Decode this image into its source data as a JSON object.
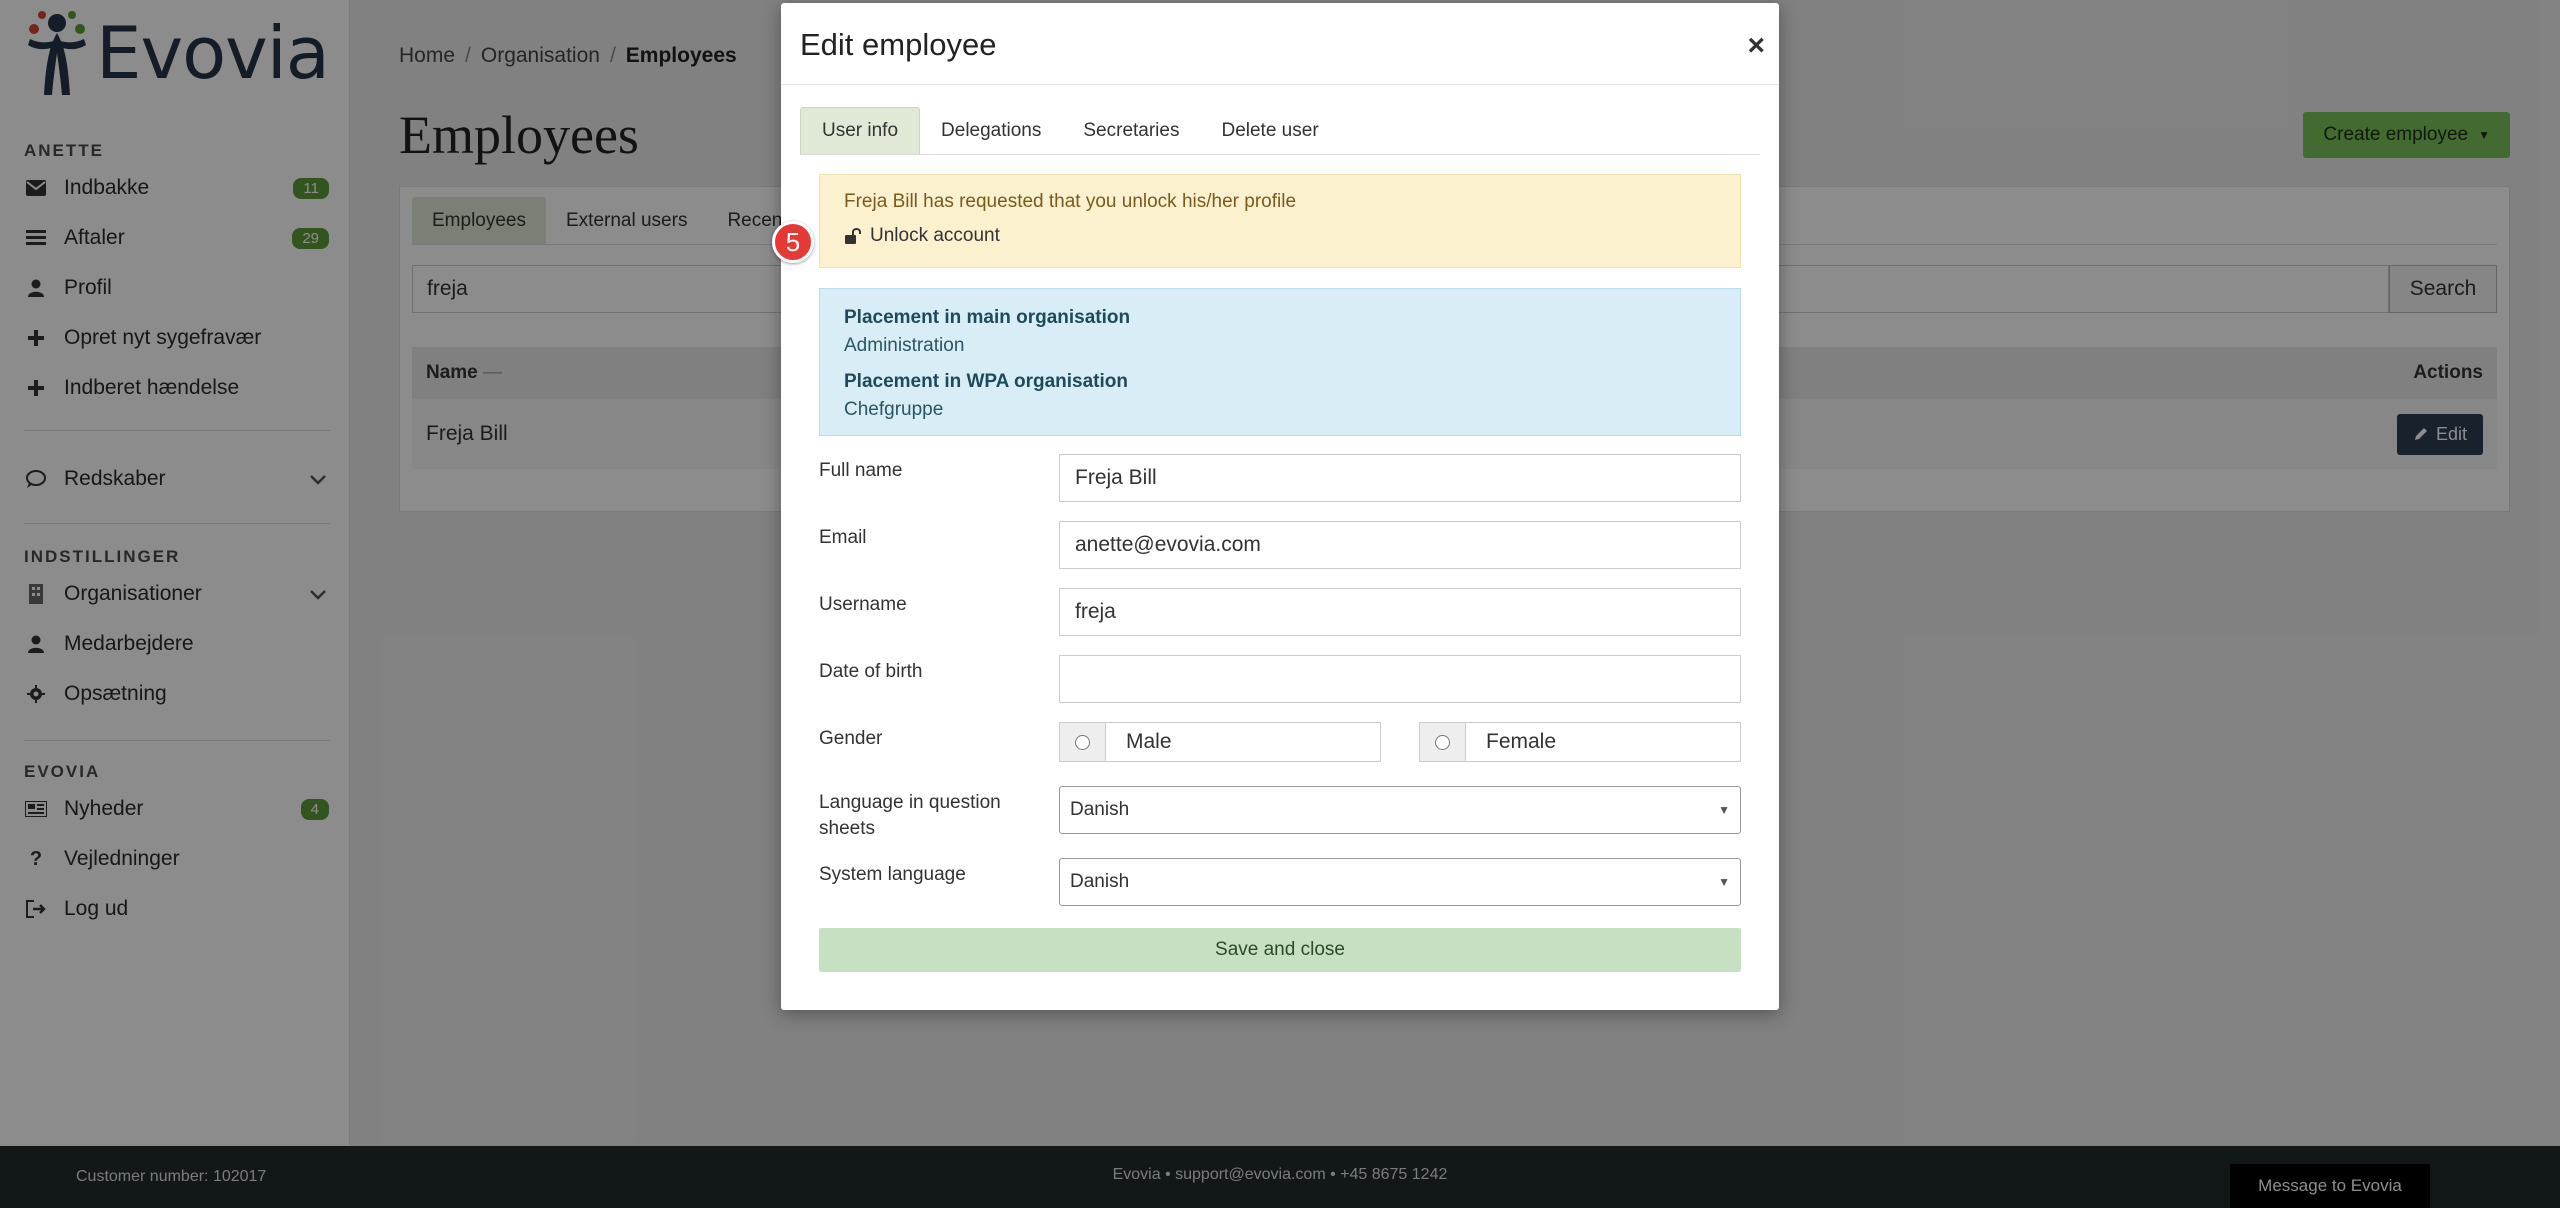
{
  "app": {
    "logo_text": "Evovia"
  },
  "sidebar": {
    "section_user": "ANETTE",
    "items_user": [
      {
        "label": "Indbakke",
        "badge": "11",
        "icon": "envelope-icon"
      },
      {
        "label": "Aftaler",
        "badge": "29",
        "icon": "list-icon"
      },
      {
        "label": "Profil",
        "icon": "user-icon"
      },
      {
        "label": "Opret nyt sygefravær",
        "icon": "plus-icon"
      },
      {
        "label": "Indberet hændelse",
        "icon": "plus-icon"
      }
    ],
    "tools": {
      "label": "Redskaber",
      "icon": "chat-icon"
    },
    "section_settings": "INDSTILLINGER",
    "items_settings": [
      {
        "label": "Organisationer",
        "icon": "building-icon"
      },
      {
        "label": "Medarbejdere",
        "icon": "user-icon"
      },
      {
        "label": "Opsætning",
        "icon": "gear-icon"
      }
    ],
    "section_evovia": "EVOVIA",
    "items_evovia": [
      {
        "label": "Nyheder",
        "badge": "4",
        "icon": "newspaper-icon"
      },
      {
        "label": "Vejledninger",
        "icon": "question-icon"
      },
      {
        "label": "Log ud",
        "icon": "logout-icon"
      }
    ]
  },
  "main": {
    "breadcrumb": [
      "Home",
      "Organisation",
      "Employees"
    ],
    "title": "Employees",
    "create_button": "Create employee",
    "tabs": [
      "Employees",
      "External users",
      "Recent"
    ],
    "search_value": "freja",
    "search_button": "Search",
    "table": {
      "col_name": "Name",
      "sort_indicator": "—",
      "col_actions": "Actions",
      "rows": [
        {
          "name": "Freja Bill",
          "action": "Edit"
        }
      ]
    }
  },
  "footer": {
    "customer": "Customer number: 102017",
    "contact": "Evovia • support@evovia.com • +45 8675 1242",
    "message_button": "Message to Evovia"
  },
  "modal": {
    "title": "Edit employee",
    "close": "×",
    "tabs": [
      "User info",
      "Delegations",
      "Secretaries",
      "Delete user"
    ],
    "step_number": "5",
    "warning": {
      "text": "Freja Bill has requested that you unlock his/her profile",
      "unlock_label": "Unlock account"
    },
    "info": {
      "main_org_label": "Placement in main organisation",
      "main_org_value": "Administration",
      "wpa_org_label": "Placement in WPA organisation",
      "wpa_org_value": "Chefgruppe"
    },
    "fields": {
      "full_name_label": "Full name",
      "full_name_value": "Freja Bill",
      "email_label": "Email",
      "email_value": "anette@evovia.com",
      "username_label": "Username",
      "username_value": "freja",
      "dob_label": "Date of birth",
      "dob_value": "",
      "gender_label": "Gender",
      "gender_male": "Male",
      "gender_female": "Female",
      "lang_q_label": "Language in question sheets",
      "lang_q_value": "Danish",
      "sys_lang_label": "System language",
      "sys_lang_value": "Danish"
    },
    "save_button": "Save and close"
  }
}
